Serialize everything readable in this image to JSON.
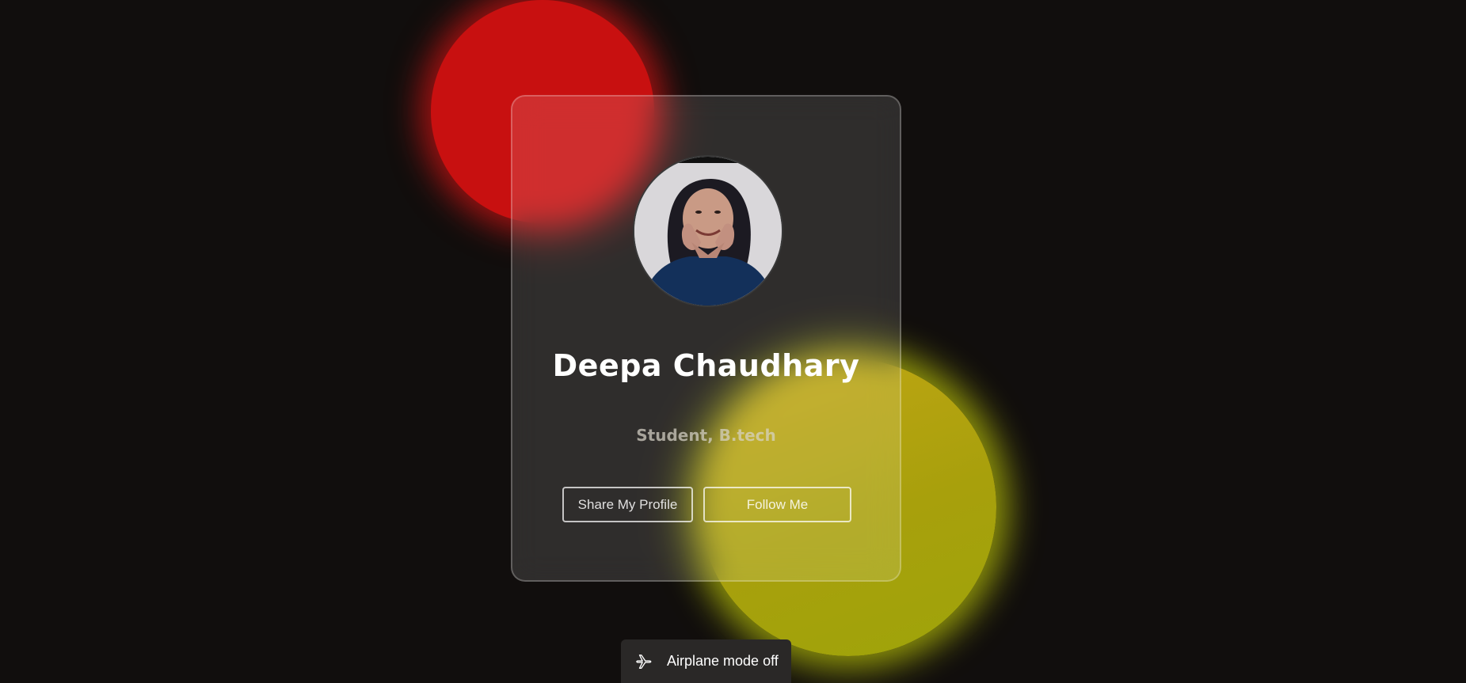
{
  "profile": {
    "name": "Deepa Chaudhary",
    "role": "Student, B.tech",
    "avatar_icon": "profile-photo"
  },
  "actions": {
    "share_label": "Share My Profile",
    "follow_label": "Follow Me"
  },
  "notification": {
    "icon": "airplane-icon",
    "text": "Airplane mode off"
  },
  "colors": {
    "background": "#110e0d",
    "blob_red": "#c81010",
    "blob_yellow": "#a8a00c"
  }
}
